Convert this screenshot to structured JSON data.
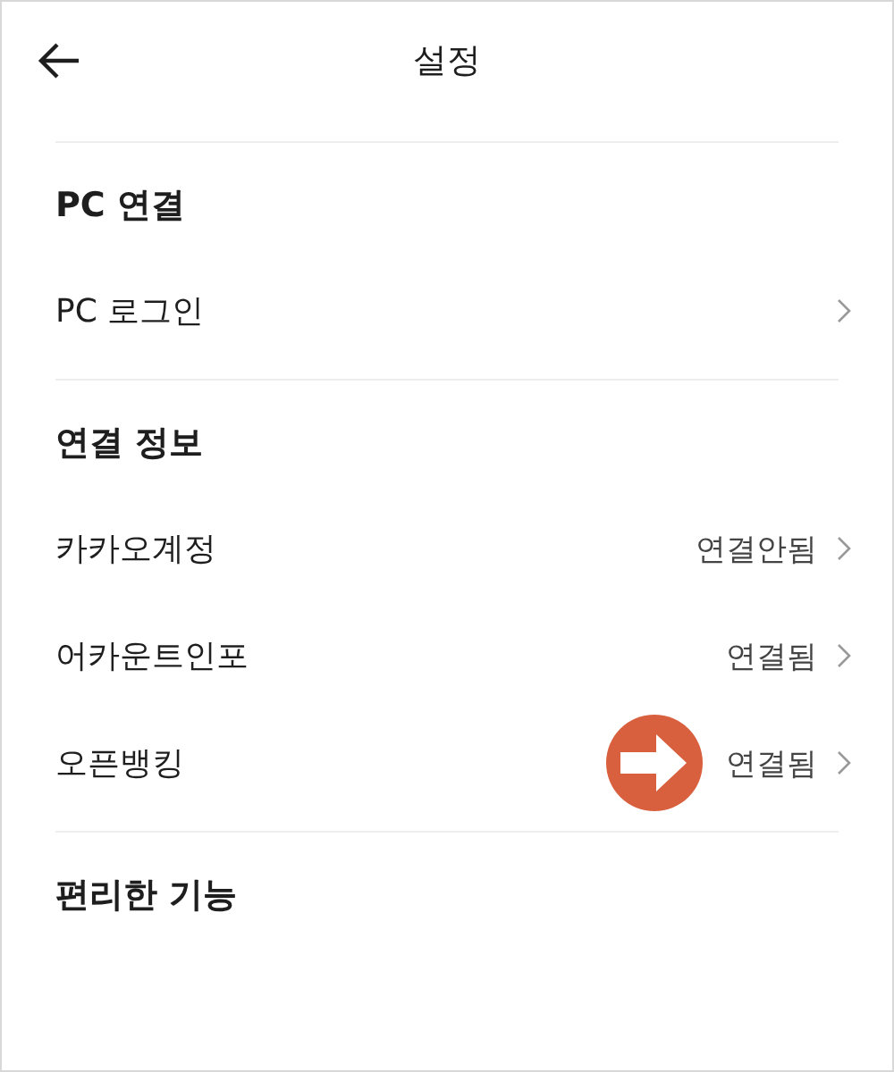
{
  "header": {
    "title": "설정"
  },
  "sections": [
    {
      "title": "PC 연결",
      "items": [
        {
          "label": "PC 로그인",
          "pointer": false
        }
      ]
    },
    {
      "title": "연결 정보",
      "items": [
        {
          "label": "카카오계정",
          "value": "연결안됨",
          "pointer": false
        },
        {
          "label": "어카운트인포",
          "value": "연결됨",
          "pointer": false
        },
        {
          "label": "오픈뱅킹",
          "value": "연결됨",
          "pointer": true
        }
      ]
    },
    {
      "title": "편리한 기능"
    }
  ]
}
